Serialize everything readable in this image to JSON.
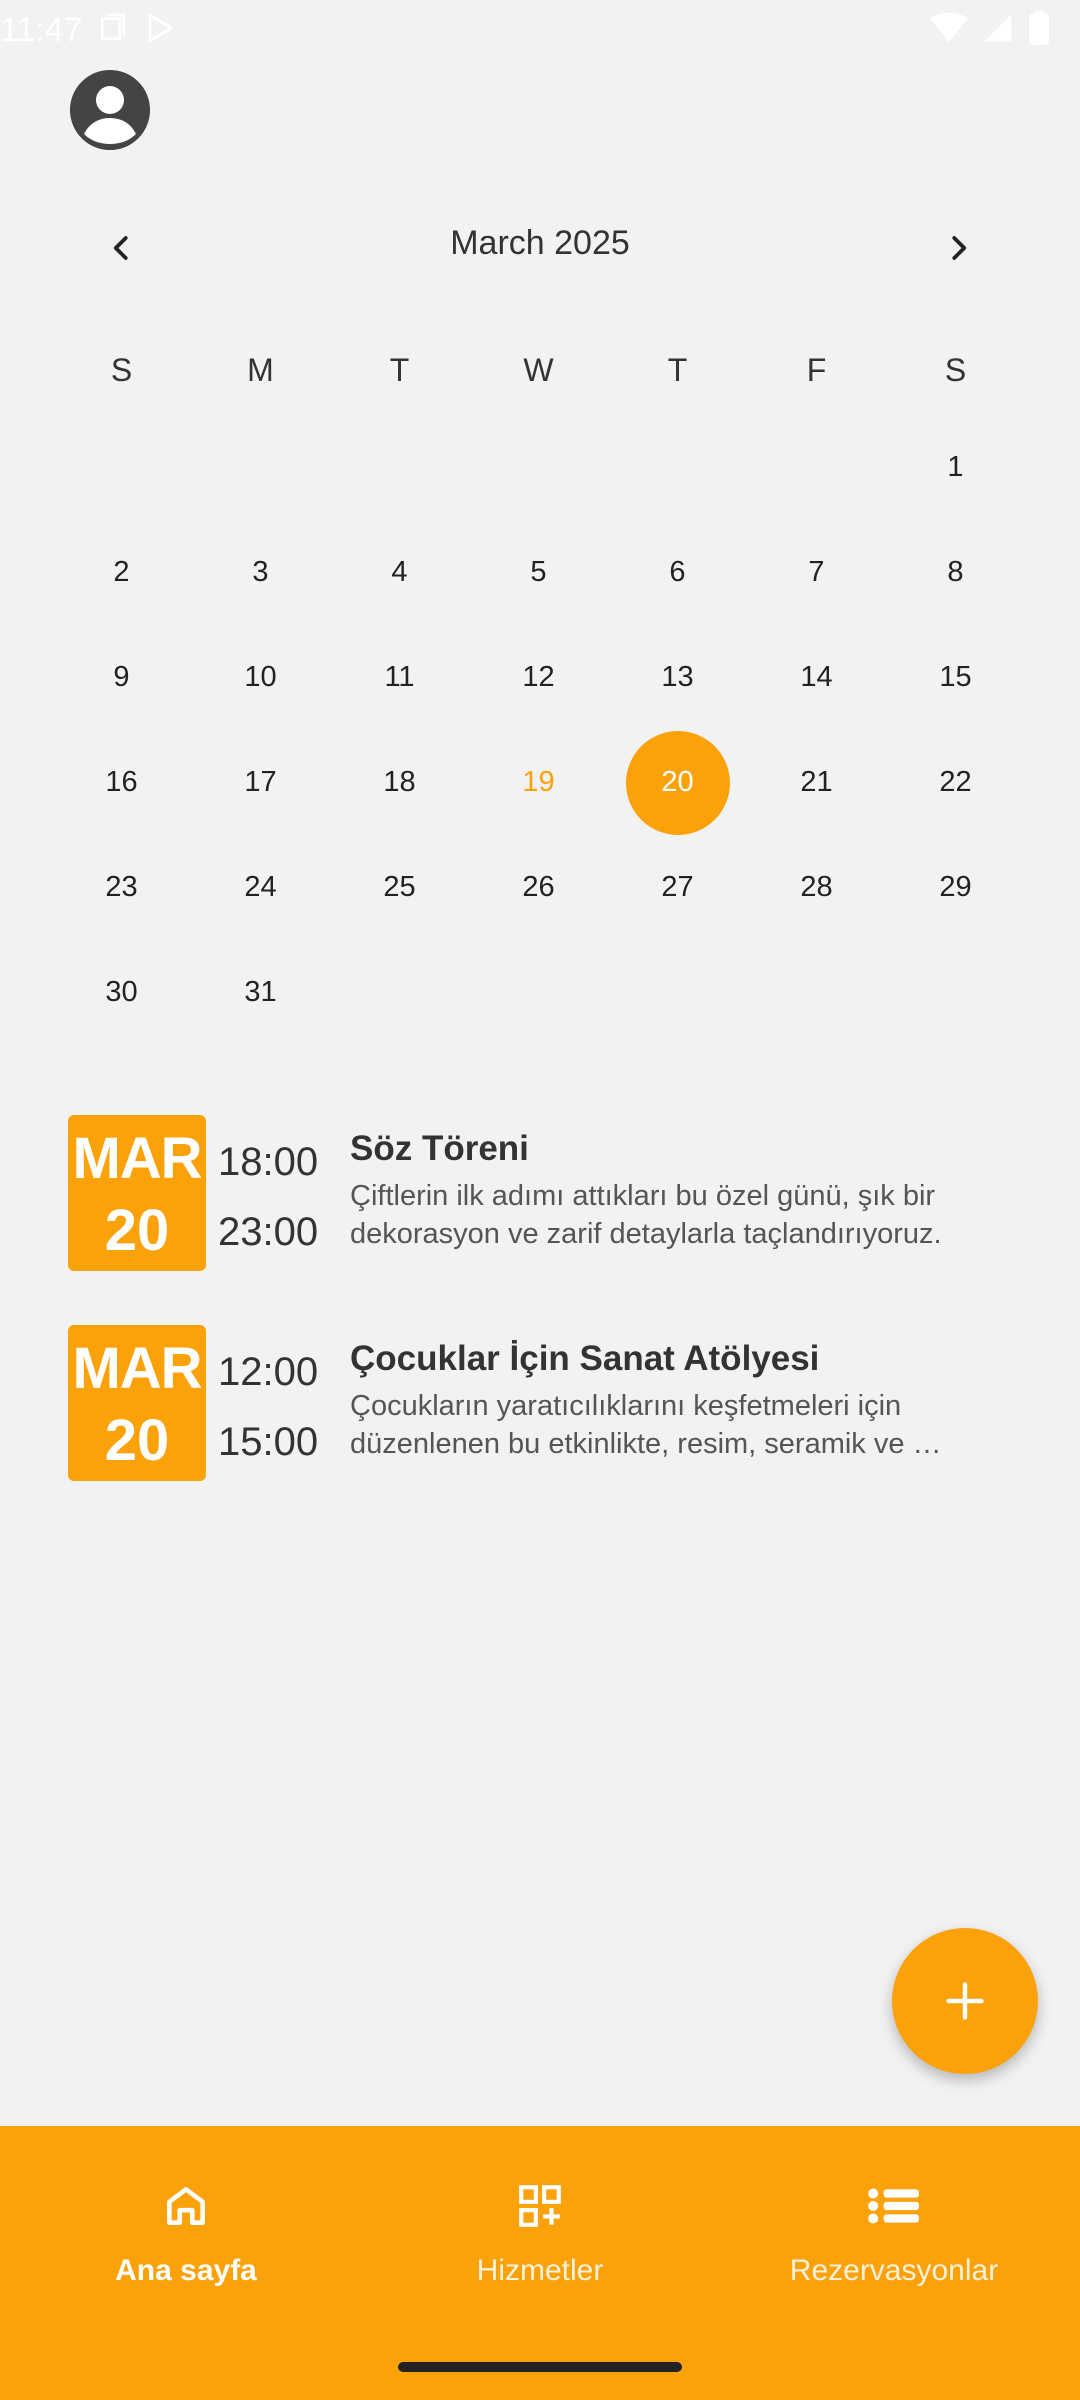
{
  "status_bar": {
    "time": "11:47"
  },
  "calendar": {
    "month_title": "March 2025",
    "weekdays": [
      "S",
      "M",
      "T",
      "W",
      "T",
      "F",
      "S"
    ],
    "weeks": [
      [
        "",
        "",
        "",
        "",
        "",
        "",
        "1"
      ],
      [
        "2",
        "3",
        "4",
        "5",
        "6",
        "7",
        "8"
      ],
      [
        "9",
        "10",
        "11",
        "12",
        "13",
        "14",
        "15"
      ],
      [
        "16",
        "17",
        "18",
        "19",
        "20",
        "21",
        "22"
      ],
      [
        "23",
        "24",
        "25",
        "26",
        "27",
        "28",
        "29"
      ],
      [
        "30",
        "31",
        "",
        "",
        "",
        "",
        ""
      ]
    ],
    "today": "19",
    "selected": "20"
  },
  "events": [
    {
      "month": "MAR",
      "day": "20",
      "start": "18:00",
      "end": "23:00",
      "title": "Söz Töreni",
      "description": "Çiftlerin ilk adımı attıkları bu özel günü, şık bir dekorasyon ve zarif detaylarla taçlandırıyoruz."
    },
    {
      "month": "MAR",
      "day": "20",
      "start": "12:00",
      "end": "15:00",
      "title": "Çocuklar İçin Sanat Atölyesi",
      "description": "Çocukların yaratıcılıklarını keşfetmeleri için düzenlenen bu etkinlikte, resim, seramik ve …"
    }
  ],
  "bottom_nav": {
    "items": [
      {
        "label": "Ana sayfa",
        "icon": "home-icon",
        "active": true
      },
      {
        "label": "Hizmetler",
        "icon": "grid-add-icon",
        "active": false
      },
      {
        "label": "Rezervasyonlar",
        "icon": "list-icon",
        "active": false
      }
    ]
  },
  "colors": {
    "accent": "#fba10a",
    "background": "#f2f2f2"
  }
}
